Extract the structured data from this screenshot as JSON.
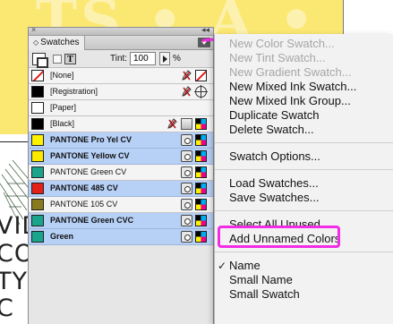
{
  "background_document": {
    "ghost_text": "TS • A • RICA",
    "text_lines": [
      "VIDE",
      "CO",
      "TY",
      "C"
    ]
  },
  "panel": {
    "close_glyph": "×",
    "collapse_glyph": "◂◂",
    "tab_arrows": "◇",
    "tab_label": "Swatches",
    "tint_label": "Tint:",
    "tint_value": "100",
    "tint_unit": "%",
    "swatches": [
      {
        "name": "[None]",
        "color": "none",
        "bold": false,
        "selected": false,
        "icons": [
          "noedit",
          "noneframe"
        ]
      },
      {
        "name": "[Registration]",
        "color": "#000000",
        "bold": false,
        "selected": false,
        "icons": [
          "noedit",
          "regtarget"
        ]
      },
      {
        "name": "[Paper]",
        "color": "#ffffff",
        "bold": false,
        "selected": false,
        "icons": []
      },
      {
        "name": "[Black]",
        "color": "#000000",
        "bold": false,
        "selected": false,
        "icons": [
          "noedit",
          "gray",
          "cmyk"
        ]
      },
      {
        "name": "PANTONE Pro Yel CV",
        "color": "#fff200",
        "bold": true,
        "selected": true,
        "icons": [
          "spot",
          "cmyk"
        ]
      },
      {
        "name": "PANTONE Yellow CV",
        "color": "#fde800",
        "bold": true,
        "selected": true,
        "icons": [
          "spot",
          "cmyk"
        ]
      },
      {
        "name": "PANTONE Green CV",
        "color": "#1aa48a",
        "bold": false,
        "selected": false,
        "icons": [
          "spot",
          "cmyk"
        ]
      },
      {
        "name": "PANTONE 485 CV",
        "color": "#e32119",
        "bold": true,
        "selected": true,
        "icons": [
          "spot",
          "cmyk"
        ]
      },
      {
        "name": "PANTONE 105 CV",
        "color": "#8a7a1e",
        "bold": false,
        "selected": false,
        "icons": [
          "spot",
          "cmyk"
        ]
      },
      {
        "name": "PANTONE Green CVC",
        "color": "#1aa48a",
        "bold": true,
        "selected": true,
        "icons": [
          "spot",
          "cmyk"
        ]
      },
      {
        "name": "Green",
        "color": "#1aa48a",
        "bold": true,
        "selected": true,
        "icons": [
          "spot",
          "cmyk"
        ]
      }
    ]
  },
  "menu": {
    "groups": [
      [
        {
          "label": "New Color Swatch...",
          "disabled": true
        },
        {
          "label": "New Tint Swatch...",
          "disabled": true
        },
        {
          "label": "New Gradient Swatch...",
          "disabled": true
        },
        {
          "label": "New Mixed Ink Swatch...",
          "disabled": false
        },
        {
          "label": "New Mixed Ink Group...",
          "disabled": false
        },
        {
          "label": "Duplicate Swatch",
          "disabled": false
        },
        {
          "label": "Delete Swatch...",
          "disabled": false
        }
      ],
      [
        {
          "label": "Swatch Options...",
          "disabled": false
        }
      ],
      [
        {
          "label": "Load Swatches...",
          "disabled": false
        },
        {
          "label": "Save Swatches...",
          "disabled": false
        }
      ],
      [
        {
          "label": "Select All Unused",
          "disabled": false,
          "highlighted": true
        },
        {
          "label": "Add Unnamed Colors",
          "disabled": false
        }
      ],
      [
        {
          "label": "Name",
          "disabled": false,
          "checked": true
        },
        {
          "label": "Small Name",
          "disabled": false
        },
        {
          "label": "Small Swatch",
          "disabled": false
        }
      ]
    ],
    "check_glyph": "✓"
  },
  "colors": {
    "highlight": "#f22ce6",
    "selection": "#b7d0f6",
    "doc_yellow": "#fbe873"
  }
}
